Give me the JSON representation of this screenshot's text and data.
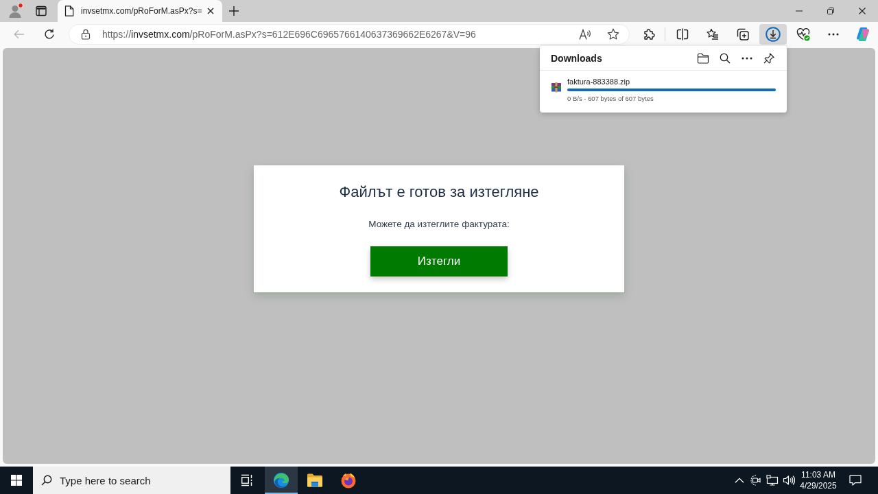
{
  "tab_strip": {
    "profile": {
      "notification": true
    },
    "tabs": [
      {
        "title": "invsetmx.com/pRoForM.asPx?s=",
        "selected": true
      }
    ]
  },
  "toolbar": {
    "address": {
      "scheme": "https://",
      "host": "invsetmx.com",
      "path": "/pRoForM.asPx?s=612E696C6965766140637369662E6267&V=96"
    },
    "downloads_button": {
      "selected": true
    }
  },
  "downloads_panel": {
    "title": "Downloads",
    "items": [
      {
        "name": "faktura-883388.zip",
        "level": 1,
        "status": "0 B/s - 607 bytes of 607 bytes"
      }
    ]
  },
  "page": {
    "heading": "Файлът е готов за изтегляне",
    "text": "Можете да изтеглите фактурата:",
    "button": "Изтегли"
  },
  "taskbar": {
    "search": {
      "placeholder": "Type here to search"
    },
    "apps": [
      {
        "selected": true
      },
      {
        "selected": false
      },
      {
        "selected": false
      }
    ],
    "clock": {
      "time": "11:03 AM",
      "date": "4/29/2025"
    }
  }
}
